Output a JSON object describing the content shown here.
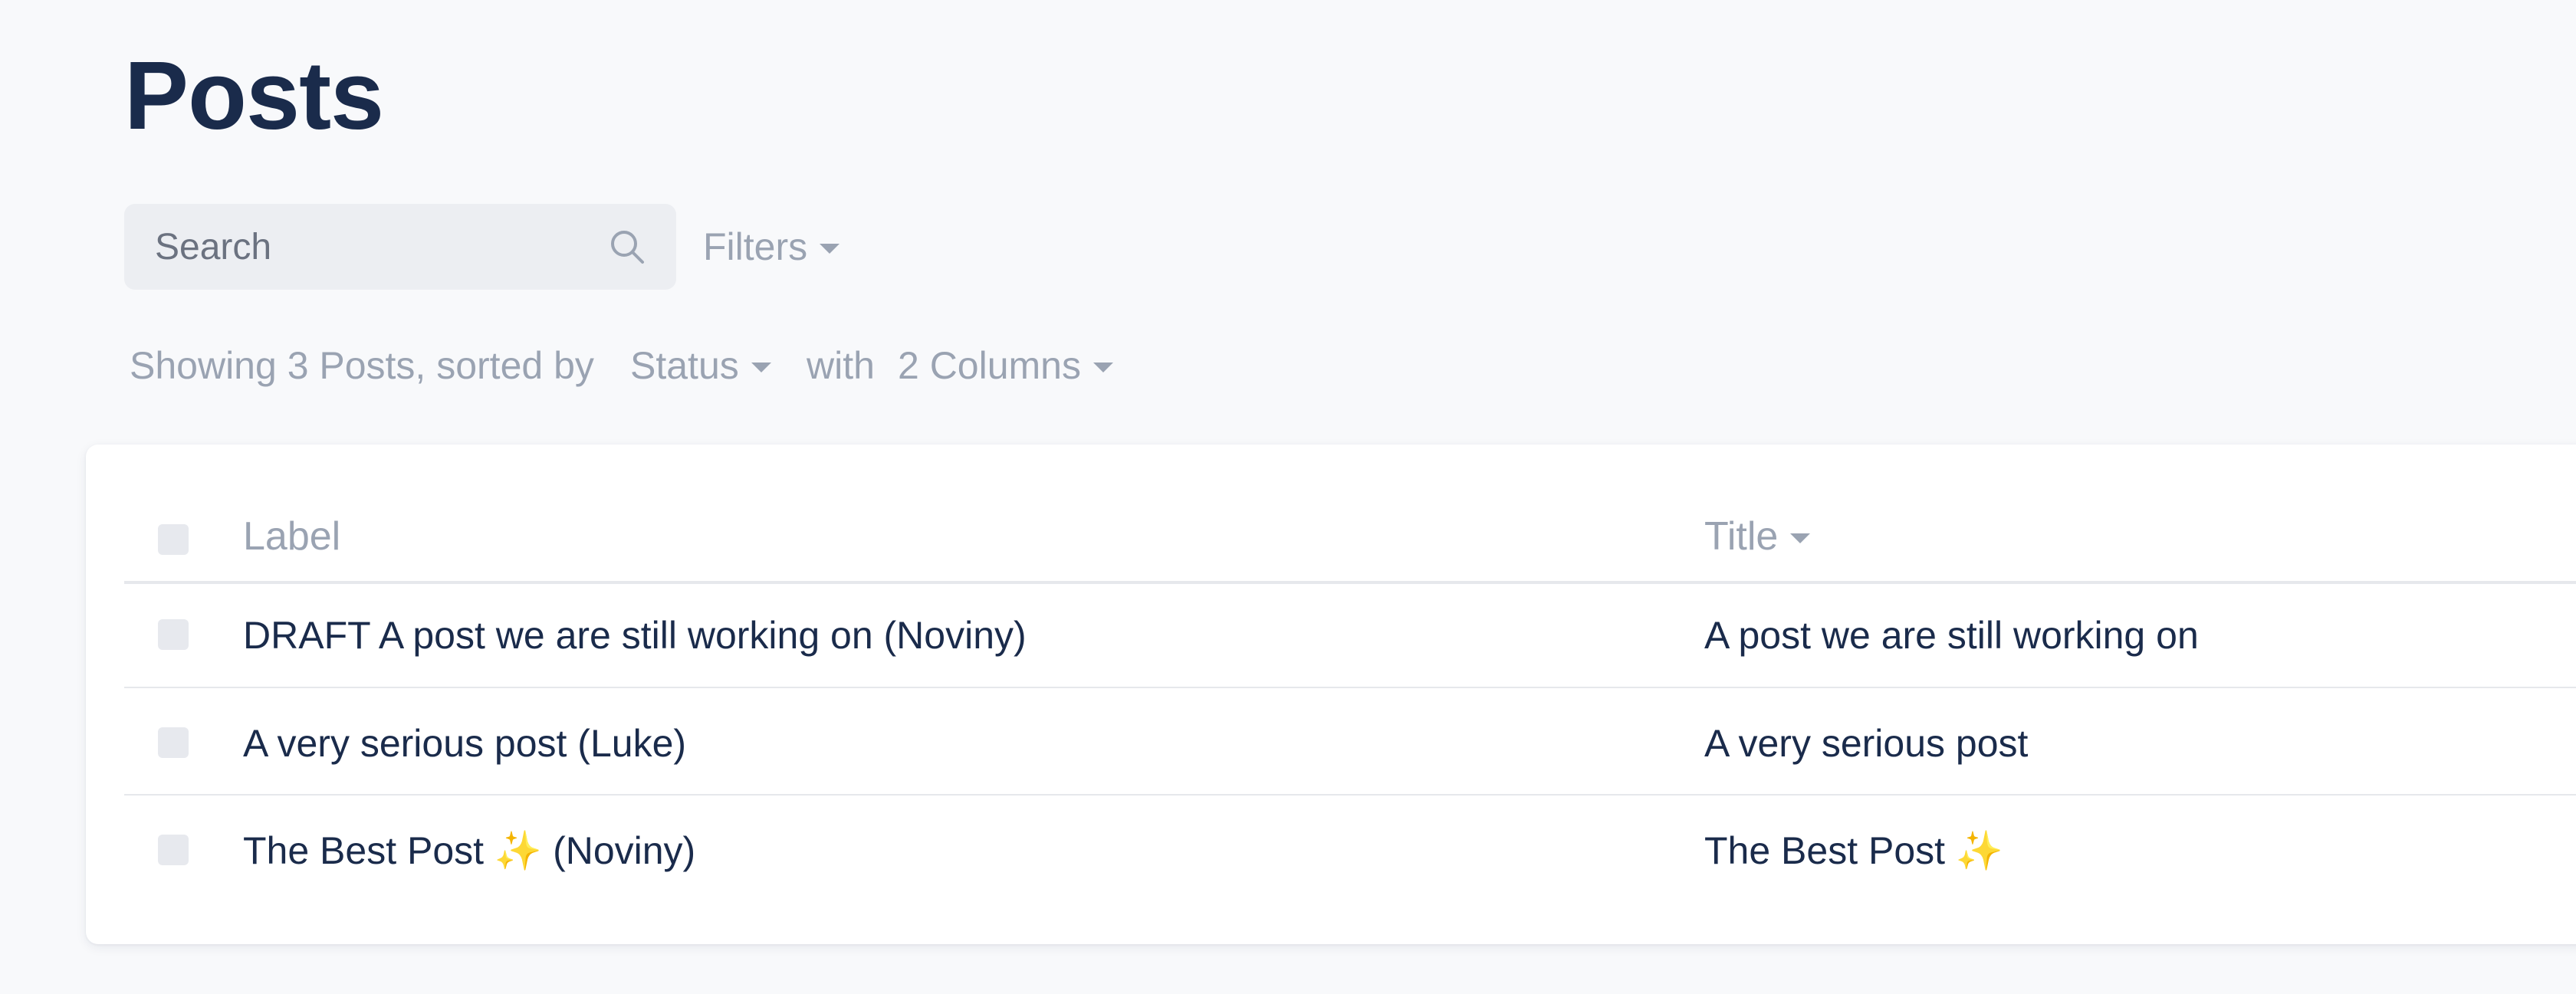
{
  "page": {
    "title": "Posts"
  },
  "search": {
    "placeholder": "Search",
    "value": ""
  },
  "filters": {
    "label": "Filters"
  },
  "summary": {
    "prefix": "Showing 3 Posts, sorted by",
    "sort_field": "Status",
    "with_label": "with",
    "columns_label": "2 Columns"
  },
  "table": {
    "columns": [
      {
        "label": "Label",
        "sortable": false
      },
      {
        "label": "Title",
        "sortable": true
      }
    ],
    "rows": [
      {
        "label": "DRAFT A post we are still working on (Noviny)",
        "title": "A post we are still working on"
      },
      {
        "label": "A very serious post (Luke)",
        "title": "A very serious post"
      },
      {
        "label": "The Best Post ✨ (Noviny)",
        "title": "The Best Post ✨"
      }
    ]
  },
  "colors": {
    "background": "#f8f9fb",
    "heading": "#1a2b4b",
    "muted": "#9aa3b2",
    "search_bg": "#eceef2",
    "checkbox": "#e7e9ee"
  },
  "icons": {
    "search": "search-icon",
    "caret": "chevron-down-icon"
  }
}
